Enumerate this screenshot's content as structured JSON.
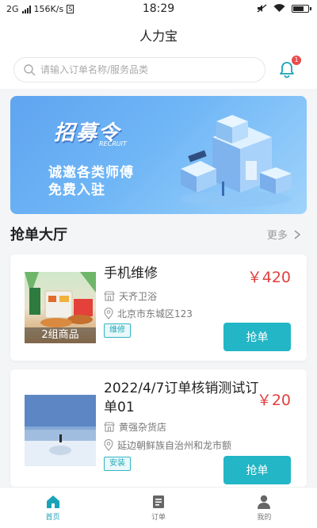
{
  "status_bar": {
    "network_left": "2G",
    "speed": "156K/s",
    "time": "18:29"
  },
  "header": {
    "title": "人力宝"
  },
  "search": {
    "placeholder": "请输入订单名称/服务品类",
    "notification_count": "1"
  },
  "banner": {
    "logo_text": "招募令",
    "logo_sub": "RECRUIT",
    "line1": "诚邀各类师傅",
    "line2": "免费入驻"
  },
  "section": {
    "title": "抢单大厅",
    "more_label": "更多"
  },
  "orders": [
    {
      "name": "手机维修",
      "price": "￥420",
      "shop": "天齐卫浴",
      "address": "北京市东城区123",
      "tag": "维修",
      "thumb_label": "2组商品",
      "button": "抢单"
    },
    {
      "name": "2022/4/7订单核销测试订单01",
      "price": "￥20",
      "shop": "黄强杂货店",
      "address": "延边朝鲜族自治州和龙市额",
      "tag": "安装",
      "button": "抢单"
    }
  ],
  "tabbar": [
    {
      "label": "首页",
      "icon": "home-icon",
      "active": true
    },
    {
      "label": "订单",
      "icon": "order-icon",
      "active": false
    },
    {
      "label": "我的",
      "icon": "user-icon",
      "active": false
    }
  ],
  "colors": {
    "accent": "#22b6c6",
    "price": "#e0403f",
    "badge": "#e84b4b"
  }
}
